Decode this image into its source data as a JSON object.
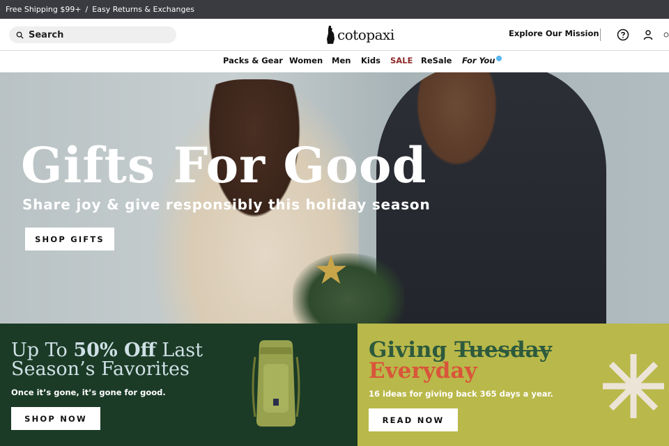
{
  "announcement": {
    "shipping": "Free Shipping $99+",
    "separator": "/",
    "returns": "Easy Returns & Exchanges"
  },
  "header": {
    "search_label": "Search",
    "logo_text": "cotopaxi",
    "mission_link": "Explore Our Mission",
    "icons": [
      "search-icon",
      "help-icon",
      "account-icon",
      "cart-icon"
    ]
  },
  "nav": {
    "items": [
      "Packs & Gear",
      "Women",
      "Men",
      "Kids",
      "SALE",
      "ReSale",
      "For You"
    ]
  },
  "hero": {
    "title": "Gifts For Good",
    "subtitle": "Share joy & give responsibly this holiday season",
    "cta": "SHOP GIFTS"
  },
  "promo_left": {
    "title_pre": "Up To ",
    "title_bold": "50% Off",
    "title_post": " Last Season’s Favorites",
    "copy": "Once it’s gone, it’s gone for good.",
    "cta": "SHOP NOW"
  },
  "promo_right": {
    "word1": "Giving",
    "word_struck": "Tuesday",
    "word2": "Everyday",
    "copy": "16 ideas for giving back 365 days a year.",
    "cta": "READ NOW"
  },
  "colors": {
    "announcement_bg": "#3a3b40",
    "sale": "#8e2a2a",
    "promo_left_bg": "#1b3b26",
    "promo_right_bg": "#b9b84a",
    "giving_green": "#2d5a3d",
    "everyday_red": "#d9553a",
    "for_you_dot": "#58b6f0"
  }
}
